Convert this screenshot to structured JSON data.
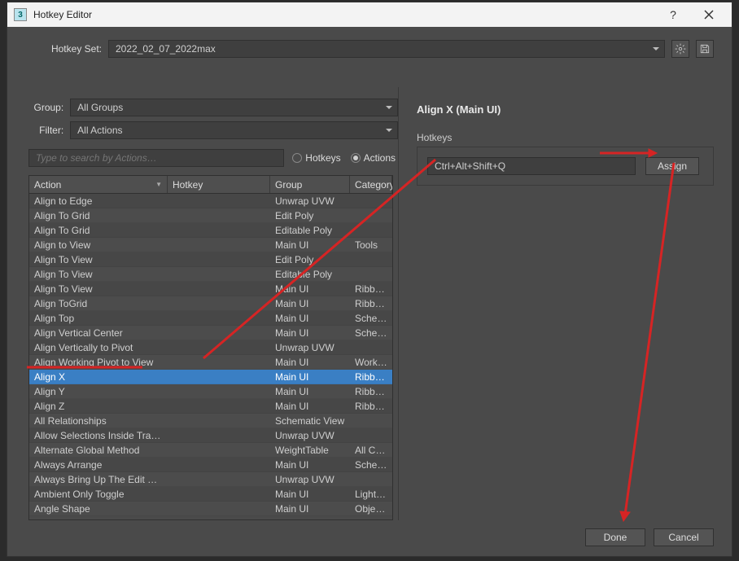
{
  "window": {
    "title": "Hotkey Editor",
    "app_icon_char": "3"
  },
  "hotkeyset": {
    "label": "Hotkey Set:",
    "value": "2022_02_07_2022max"
  },
  "filters": {
    "group_label": "Group:",
    "group_value": "All Groups",
    "filter_label": "Filter:",
    "filter_value": "All Actions",
    "search_placeholder": "Type to search by Actions…"
  },
  "radio": {
    "hotkeys_label": "Hotkeys",
    "actions_label": "Actions",
    "selected": "actions"
  },
  "table": {
    "headers": {
      "action": "Action",
      "hotkey": "Hotkey",
      "group": "Group",
      "category": "Category"
    },
    "rows": [
      {
        "action": "Align to Edge",
        "hotkey": "",
        "group": "Unwrap UVW",
        "cat": ""
      },
      {
        "action": "Align To Grid",
        "hotkey": "",
        "group": "Edit Poly",
        "cat": ""
      },
      {
        "action": "Align To Grid",
        "hotkey": "",
        "group": "Editable Poly",
        "cat": ""
      },
      {
        "action": "Align to View",
        "hotkey": "",
        "group": "Main UI",
        "cat": "Tools"
      },
      {
        "action": "Align To View",
        "hotkey": "",
        "group": "Edit Poly",
        "cat": ""
      },
      {
        "action": "Align To View",
        "hotkey": "",
        "group": "Editable Poly",
        "cat": ""
      },
      {
        "action": "Align To View",
        "hotkey": "",
        "group": "Main UI",
        "cat": "Ribbon - M"
      },
      {
        "action": "Align ToGrid",
        "hotkey": "",
        "group": "Main UI",
        "cat": "Ribbon - M"
      },
      {
        "action": "Align Top",
        "hotkey": "",
        "group": "Main UI",
        "cat": "Schematic"
      },
      {
        "action": "Align Vertical Center",
        "hotkey": "",
        "group": "Main UI",
        "cat": "Schematic"
      },
      {
        "action": "Align Vertically to Pivot",
        "hotkey": "",
        "group": "Unwrap UVW",
        "cat": ""
      },
      {
        "action": "Align Working Pivot to View",
        "hotkey": "",
        "group": "Main UI",
        "cat": "Working P"
      },
      {
        "action": "Align X",
        "hotkey": "",
        "group": "Main UI",
        "cat": "Ribbon - M",
        "selected": true
      },
      {
        "action": "Align Y",
        "hotkey": "",
        "group": "Main UI",
        "cat": "Ribbon - M"
      },
      {
        "action": "Align Z",
        "hotkey": "",
        "group": "Main UI",
        "cat": "Ribbon - M"
      },
      {
        "action": "All Relationships",
        "hotkey": "",
        "group": "Schematic View",
        "cat": ""
      },
      {
        "action": "Allow Selections Inside Tranform …",
        "hotkey": "",
        "group": "Unwrap UVW",
        "cat": ""
      },
      {
        "action": "Alternate Global Method",
        "hotkey": "",
        "group": "WeightTable",
        "cat": "All Comma"
      },
      {
        "action": "Always Arrange",
        "hotkey": "",
        "group": "Main UI",
        "cat": "Schematic"
      },
      {
        "action": "Always Bring Up The Edit Window",
        "hotkey": "",
        "group": "Unwrap UVW",
        "cat": ""
      },
      {
        "action": "Ambient Only Toggle",
        "hotkey": "",
        "group": "Main UI",
        "cat": "Lights and"
      },
      {
        "action": "Angle Shape",
        "hotkey": "",
        "group": "Main UI",
        "cat": "Objects Sh"
      }
    ]
  },
  "detail": {
    "title": "Align X (Main UI)",
    "section": "Hotkeys",
    "input_value": "Ctrl+Alt+Shift+Q",
    "assign": "Assign"
  },
  "footer": {
    "done": "Done",
    "cancel": "Cancel"
  }
}
